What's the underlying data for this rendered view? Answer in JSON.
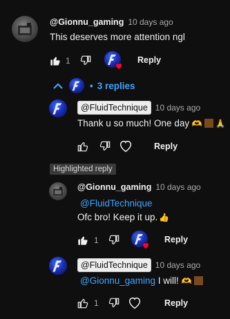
{
  "comments": [
    {
      "author": "@Gionnu_gaming",
      "time": "10 days ago",
      "text": "This deserves more attention ngl",
      "likes": "1",
      "reply_label": "Reply"
    }
  ],
  "replies_toggle": {
    "label": "3 replies"
  },
  "replies": [
    {
      "author": "@FluidTechnique",
      "time": "10 days ago",
      "text": "Thank u so much! One day",
      "reply_label": "Reply"
    },
    {
      "highlight_label": "Highlighted reply",
      "author": "@Gionnu_gaming",
      "time": "10 days ago",
      "mention": "@FluidTechnique",
      "text": "Ofc bro! Keep it up.",
      "likes": "1",
      "reply_label": "Reply"
    },
    {
      "author": "@FluidTechnique",
      "time": "10 days ago",
      "mention": "@Gionnu_gaming",
      "text": " I will!",
      "likes": "1",
      "reply_label": "Reply"
    }
  ],
  "colors": {
    "background": "#0f0f0f",
    "link": "#3ea6ff",
    "heart": "#ff0033",
    "muted": "#aaaaaa"
  }
}
